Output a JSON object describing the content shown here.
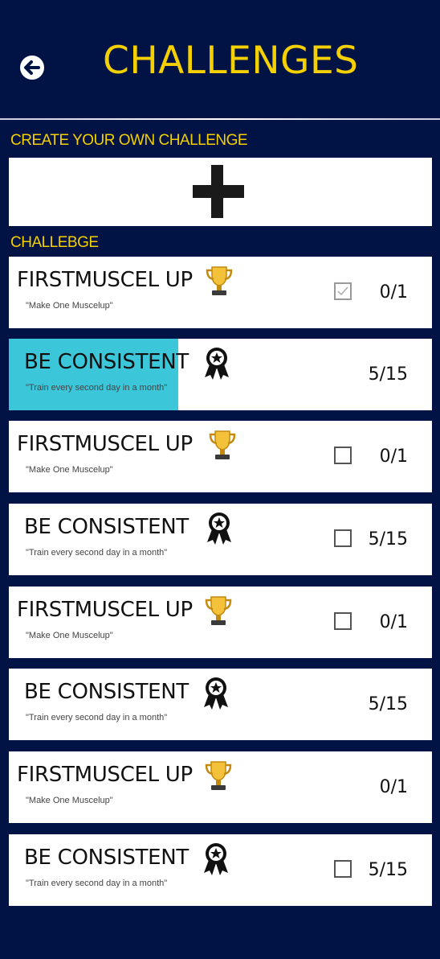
{
  "header": {
    "title": "CHALLENGES",
    "back_icon": "back-arrow-icon"
  },
  "create_section": {
    "label": "CREATE YOUR OWN CHALLENGE",
    "add_icon": "plus-icon"
  },
  "challenge_section": {
    "label": "CHALLEBGE"
  },
  "colors": {
    "background": "#011244",
    "accent": "#F5D000",
    "progress": "#3BC6D9"
  },
  "challenges": [
    {
      "title": "FIRSTMUSCEL UP",
      "desc": "\"Make One Muscelup\"",
      "icon": "trophy-icon",
      "count": "0/1",
      "checkbox": "checked",
      "progress": 0
    },
    {
      "title": "BE CONSISTENT",
      "desc": "\"Train every second day in a month\"",
      "icon": "award-ribbon-icon",
      "count": "5/15",
      "checkbox": "none",
      "progress": 0.4
    },
    {
      "title": "FIRSTMUSCEL UP",
      "desc": "\"Make One Muscelup\"",
      "icon": "trophy-icon",
      "count": "0/1",
      "checkbox": "unchecked",
      "progress": 0
    },
    {
      "title": "BE CONSISTENT",
      "desc": "\"Train every second day in a month\"",
      "icon": "award-ribbon-icon",
      "count": "5/15",
      "checkbox": "unchecked",
      "progress": 0
    },
    {
      "title": "FIRSTMUSCEL UP",
      "desc": "\"Make One Muscelup\"",
      "icon": "trophy-icon",
      "count": "0/1",
      "checkbox": "unchecked",
      "progress": 0
    },
    {
      "title": "BE CONSISTENT",
      "desc": "\"Train every second day in a month\"",
      "icon": "award-ribbon-icon",
      "count": "5/15",
      "checkbox": "none",
      "progress": 0
    },
    {
      "title": "FIRSTMUSCEL UP",
      "desc": "\"Make One Muscelup\"",
      "icon": "trophy-icon",
      "count": "0/1",
      "checkbox": "none",
      "progress": 0
    },
    {
      "title": "BE CONSISTENT",
      "desc": "\"Train every second day in a month\"",
      "icon": "award-ribbon-icon",
      "count": "5/15",
      "checkbox": "unchecked",
      "progress": 0
    }
  ]
}
